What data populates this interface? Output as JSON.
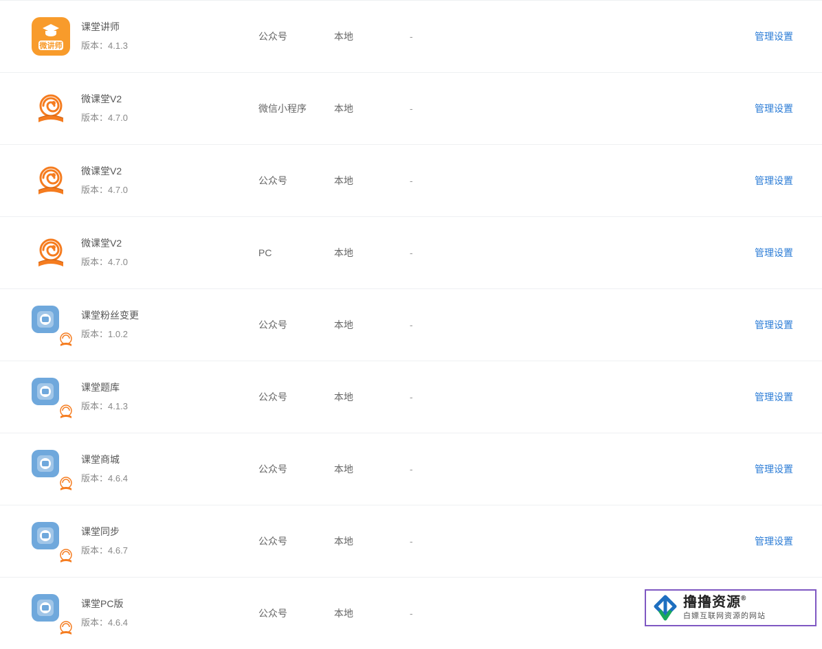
{
  "version_prefix": "版本：",
  "action_label": "管理设置",
  "watermark": {
    "title": "撸撸资源",
    "reg": "®",
    "subtitle": "白嫖互联网资源的网站"
  },
  "rows": [
    {
      "name": "课堂讲师",
      "version": "4.1.3",
      "type": "公众号",
      "location": "本地",
      "extra": "-",
      "icon": "weijiangshi"
    },
    {
      "name": "微课堂V2",
      "version": "4.7.0",
      "type": "微信小程序",
      "location": "本地",
      "extra": "-",
      "icon": "weiketang"
    },
    {
      "name": "微课堂V2",
      "version": "4.7.0",
      "type": "公众号",
      "location": "本地",
      "extra": "-",
      "icon": "weiketang"
    },
    {
      "name": "微课堂V2",
      "version": "4.7.0",
      "type": "PC",
      "location": "本地",
      "extra": "-",
      "icon": "weiketang"
    },
    {
      "name": "课堂粉丝变更",
      "version": "1.0.2",
      "type": "公众号",
      "location": "本地",
      "extra": "-",
      "icon": "blue-badge"
    },
    {
      "name": "课堂题库",
      "version": "4.1.3",
      "type": "公众号",
      "location": "本地",
      "extra": "-",
      "icon": "blue-badge"
    },
    {
      "name": "课堂商城",
      "version": "4.6.4",
      "type": "公众号",
      "location": "本地",
      "extra": "-",
      "icon": "blue-badge"
    },
    {
      "name": "课堂同步",
      "version": "4.6.7",
      "type": "公众号",
      "location": "本地",
      "extra": "-",
      "icon": "blue-badge"
    },
    {
      "name": "课堂PC版",
      "version": "4.6.4",
      "type": "公众号",
      "location": "本地",
      "extra": "-",
      "icon": "blue-badge"
    }
  ]
}
